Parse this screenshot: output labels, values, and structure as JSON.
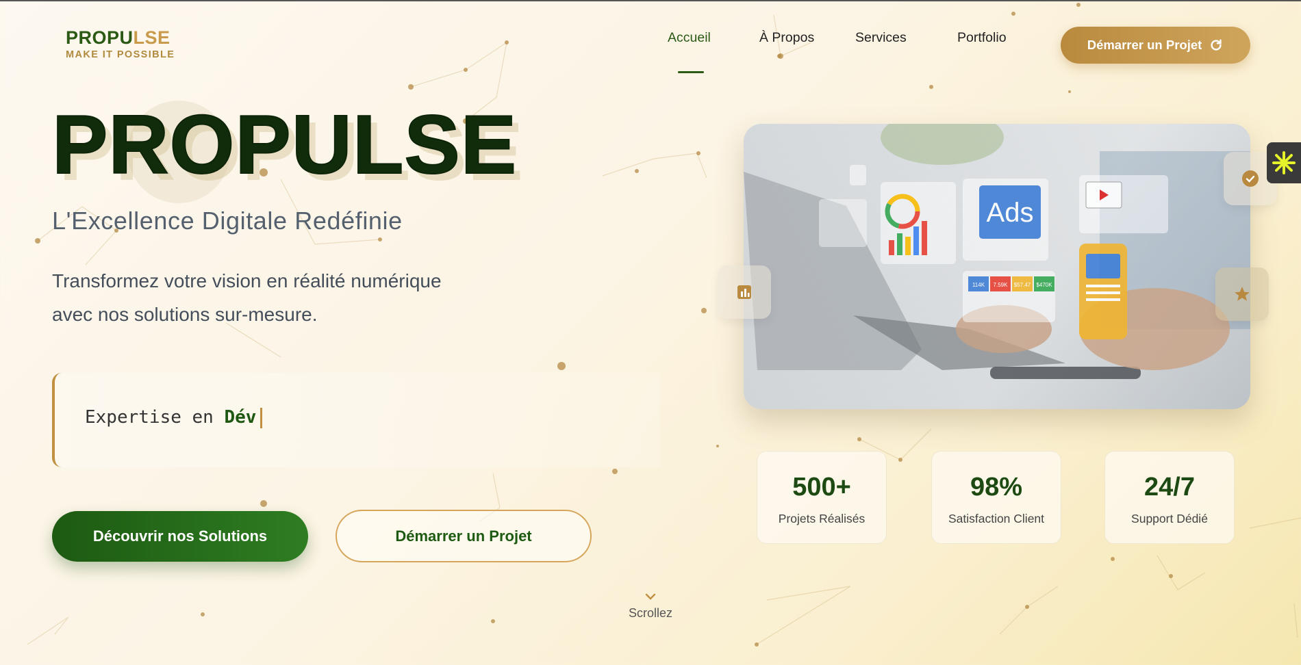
{
  "header": {
    "logo_part1": "PROPU",
    "logo_part2": "LSE",
    "logo_tagline": "MAKE IT POSSIBLE",
    "nav": [
      {
        "label": "Accueil",
        "active": true
      },
      {
        "label": "À Propos",
        "active": false
      },
      {
        "label": "Services",
        "active": false
      },
      {
        "label": "Portfolio",
        "active": false
      }
    ],
    "cta_label": "Démarrer un Projet"
  },
  "hero": {
    "title": "PROPULSE",
    "subtitle": "L'Excellence Digitale Redéfinie",
    "description_line1": "Transformez votre vision en réalité numérique",
    "description_line2": "avec nos solutions sur-mesure.",
    "typing_prefix": "Expertise en",
    "typing_word": "Dév",
    "primary_button": "Découvrir nos Solutions",
    "secondary_button": "Démarrer un Projet",
    "scroll_label": "Scrollez"
  },
  "image_overlay": {
    "ads_label": "Ads",
    "metrics": [
      "114K",
      "7.59K",
      "$57.47",
      "$470K"
    ]
  },
  "stats": [
    {
      "value": "500+",
      "label": "Projets Réalisés"
    },
    {
      "value": "98%",
      "label": "Satisfaction Client"
    },
    {
      "value": "24/7",
      "label": "Support Dédié"
    }
  ],
  "icons": {
    "cta": "refresh-icon",
    "scroll": "chevron-down-icon",
    "floating": [
      "chart-icon",
      "check-icon",
      "star-icon"
    ],
    "widget": "asterisk-icon"
  },
  "colors": {
    "brand_green": "#2a5a14",
    "brand_gold": "#c99a4b",
    "background": "#fcf4e4"
  }
}
